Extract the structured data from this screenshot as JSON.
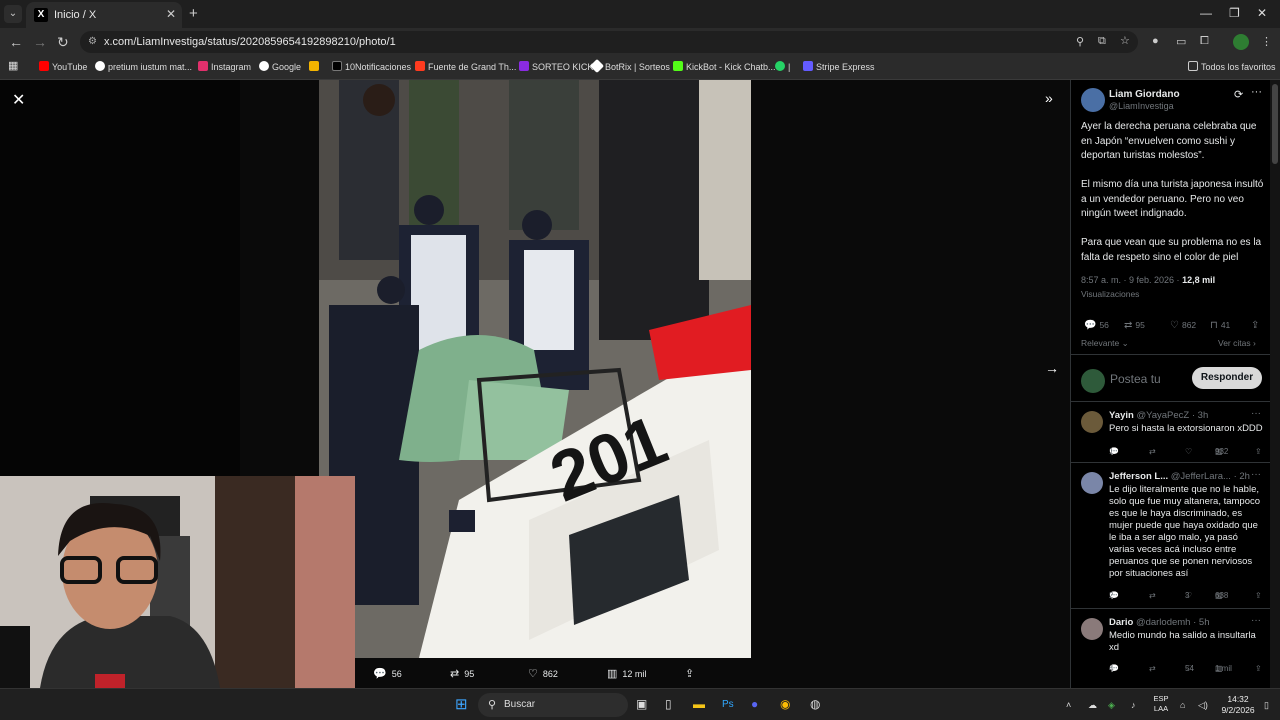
{
  "browser": {
    "tab_title": "Inicio / X",
    "tab_favicon": "X",
    "url": "x.com/LiamInvestiga/status/2020859654192898210/photo/1",
    "bookmarks": [
      {
        "label": "YouTube",
        "color": "#ff0000"
      },
      {
        "label": "pretium iustum mat...",
        "color": "#ffffff"
      },
      {
        "label": "Instagram",
        "color": "#e1306c"
      },
      {
        "label": "Google",
        "color": "#ffffff"
      },
      {
        "label": "",
        "color": "#f4b400"
      },
      {
        "label": "10Notificaciones",
        "color": "#000000"
      },
      {
        "label": "Fuente de Grand Th...",
        "color": "#ff3b1f"
      },
      {
        "label": "SORTEO KICK",
        "color": "#8a2be2"
      },
      {
        "label": "BotRix | Sorteos",
        "color": "#ffffff"
      },
      {
        "label": "KickBot - Kick Chatb...",
        "color": "#53fc18"
      },
      {
        "label": "|",
        "color": "#25d366"
      },
      {
        "label": "Stripe Express",
        "color": "#635bff"
      }
    ],
    "all_bookmarks": "Todos los favoritos"
  },
  "viewer": {
    "actions": {
      "replies": "56",
      "reposts": "95",
      "likes": "862",
      "views": "12 mil"
    },
    "photo_plate": "201"
  },
  "tweet": {
    "author_name": "Liam Giordano",
    "author_handle": "@LiamInvestiga",
    "paragraphs": [
      "Ayer la derecha peruana celebraba que en Japón “envuelven como sushi y deportan turistas molestos”.",
      "El mismo día una turista japonesa insultó a un vendedor peruano. Pero no veo ningún tweet indignado.",
      "Para que vean que su problema no es la falta de respeto sino el color de piel"
    ],
    "timestamp": "8:57 a. m. · 9 feb. 2026 · ",
    "views_count": "12,8 mil",
    "views_label": "Visualizaciones",
    "stats": {
      "replies": "56",
      "reposts": "95",
      "likes": "862",
      "bookmarks": "41"
    },
    "sort_label": "Relevante",
    "quotes_label": "Ver citas",
    "reply_placeholder": "Postea tu respuesta",
    "reply_button": "Responder"
  },
  "replies": [
    {
      "name": "Yayin",
      "handle": "@YayaPecZ · 3h",
      "text": "Pero si hasta la extorsionaron xDDD",
      "replies": "1",
      "reposts": "",
      "likes": "",
      "views": "932",
      "avatar_color": "#6b5a3a"
    },
    {
      "name": "Jefferson L...",
      "handle": "@JefferLara... · 2h",
      "text": "Le dijo literalmente que no le hable, solo que fue muy altanera, tampoco es que le haya discriminado, es mujer puede que haya oxidado que le iba a ser algo malo, ya pasó varias veces acá incluso entre peruanos que se ponen nerviosos por situaciones así",
      "replies": "2",
      "reposts": "",
      "likes": "3",
      "views": "638",
      "avatar_color": "#7a86a8"
    },
    {
      "name": "Dario",
      "handle": "@darlodemh · 5h",
      "text": "Medio mundo ha salido a insultarla xd",
      "replies": "4",
      "reposts": "",
      "likes": "54",
      "views": "1 mil",
      "avatar_color": "#8a7a7a"
    }
  ],
  "taskbar": {
    "search_label": "Buscar",
    "lang_top": "ESP",
    "lang_bottom": "LAA",
    "time": "14:32",
    "date": "9/2/2026"
  }
}
